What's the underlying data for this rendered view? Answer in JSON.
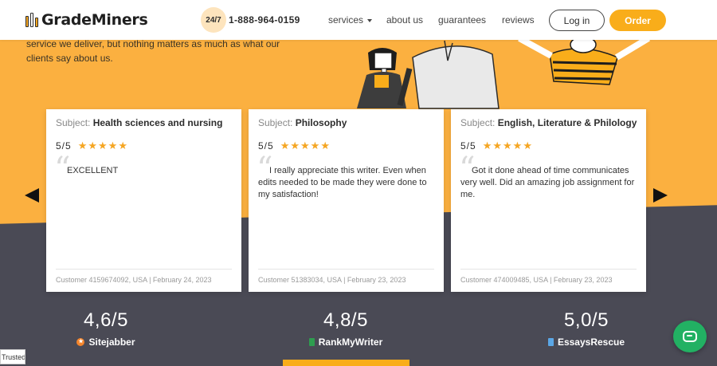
{
  "header": {
    "logo": "GradeMiners",
    "badge": "24/7",
    "phone": "1-888-964-0159",
    "nav": [
      {
        "label": "services"
      },
      {
        "label": "about us"
      },
      {
        "label": "guarantees"
      },
      {
        "label": "reviews"
      }
    ],
    "login_label": "Log in",
    "order_label": "Order"
  },
  "intro": {
    "text": "service we deliver, but nothing matters as much as what our clients say about us."
  },
  "reviews": [
    {
      "subject_label": "Subject:",
      "subject": "Health sciences and nursing",
      "rating": "5/5",
      "text": "EXCELLENT",
      "meta": "Customer 4159674092, USA | February 24, 2023"
    },
    {
      "subject_label": "Subject:",
      "subject": "Philosophy",
      "rating": "5/5",
      "text": "I really appreciate this writer. Even when edits needed to be made they were done to my satisfaction!",
      "meta": "Customer 51383034, USA | February 23, 2023"
    },
    {
      "subject_label": "Subject:",
      "subject": "English, Literature & Philology",
      "rating": "5/5",
      "text": "Got it done ahead of time communicates very well. Did an amazing job assignment for me.",
      "meta": "Customer 474009485, USA | February 23, 2023"
    }
  ],
  "scores": [
    {
      "value": "4,6/5",
      "site": "Sitejabber",
      "icon": "sitejabber-icon"
    },
    {
      "value": "4,8/5",
      "site": "RankMyWriter",
      "icon": "rankmywriter-icon"
    },
    {
      "value": "5,0/5",
      "site": "EssaysRescue",
      "icon": "essaysrescue-icon"
    }
  ],
  "trusted_badge": "TrustedSite",
  "colors": {
    "accent": "#f9ad1a",
    "background": "#fbb040",
    "dark_band": "#4a4a55",
    "chat": "#22b163"
  }
}
